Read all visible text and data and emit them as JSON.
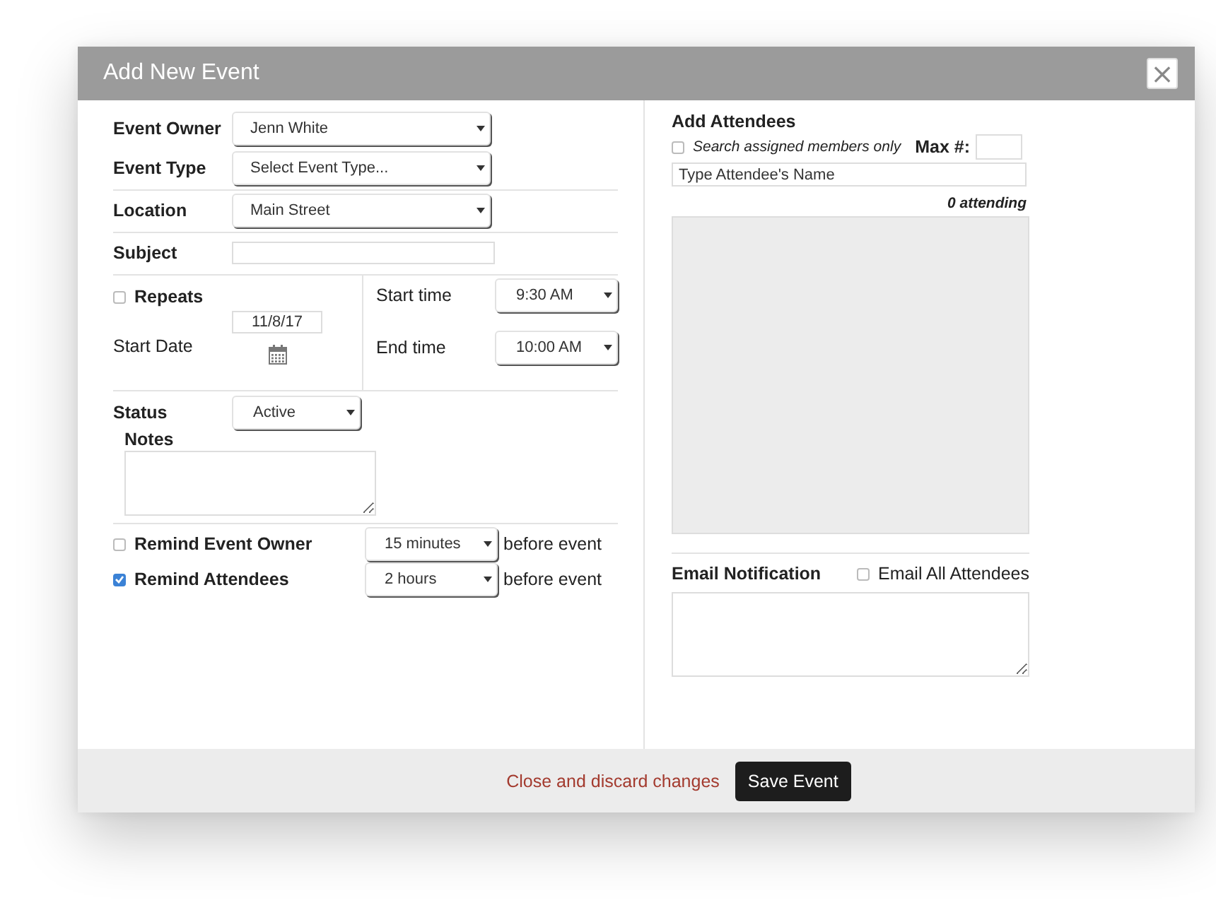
{
  "dialog": {
    "title": "Add New Event",
    "close": "×"
  },
  "field_groups": [
    [
      {
        "label": "Event Owner",
        "kind": "select",
        "value": "Jenn White"
      },
      {
        "label": "Event Type",
        "kind": "select",
        "value": "Select Event Type..."
      }
    ],
    [
      {
        "label": "Location",
        "kind": "select",
        "value": "Main Street"
      }
    ],
    [
      {
        "label": "Subject",
        "kind": "text"
      }
    ]
  ],
  "schedule": {
    "repeats": {
      "label": "Repeats",
      "checked": false
    },
    "start_date": {
      "label": "Start Date",
      "value": "11/8/17"
    },
    "times": [
      {
        "label": "Start time",
        "value": "9:30 AM"
      },
      {
        "label": "End time",
        "value": "10:00 AM"
      }
    ]
  },
  "status": {
    "label": "Status",
    "value": "Active"
  },
  "notes": {
    "label": "Notes"
  },
  "reminders": [
    {
      "label": "Remind Event Owner",
      "checked": false,
      "value": "15 minutes",
      "suffix": "before event"
    },
    {
      "label": "Remind Attendees",
      "checked": true,
      "value": "2 hours",
      "suffix": "before event"
    }
  ],
  "attendees": {
    "title": "Add Attendees",
    "search_assigned": {
      "label": "Search assigned members only",
      "checked": false
    },
    "max_label": "Max #:",
    "name_field": {
      "placeholder": "Type Attendee's Name"
    },
    "count": "0 attending"
  },
  "email": {
    "title": "Email Notification",
    "all": {
      "label": "Email All Attendees",
      "checked": false
    }
  },
  "footer": {
    "discard": "Close and discard changes",
    "save": "Save Event"
  }
}
